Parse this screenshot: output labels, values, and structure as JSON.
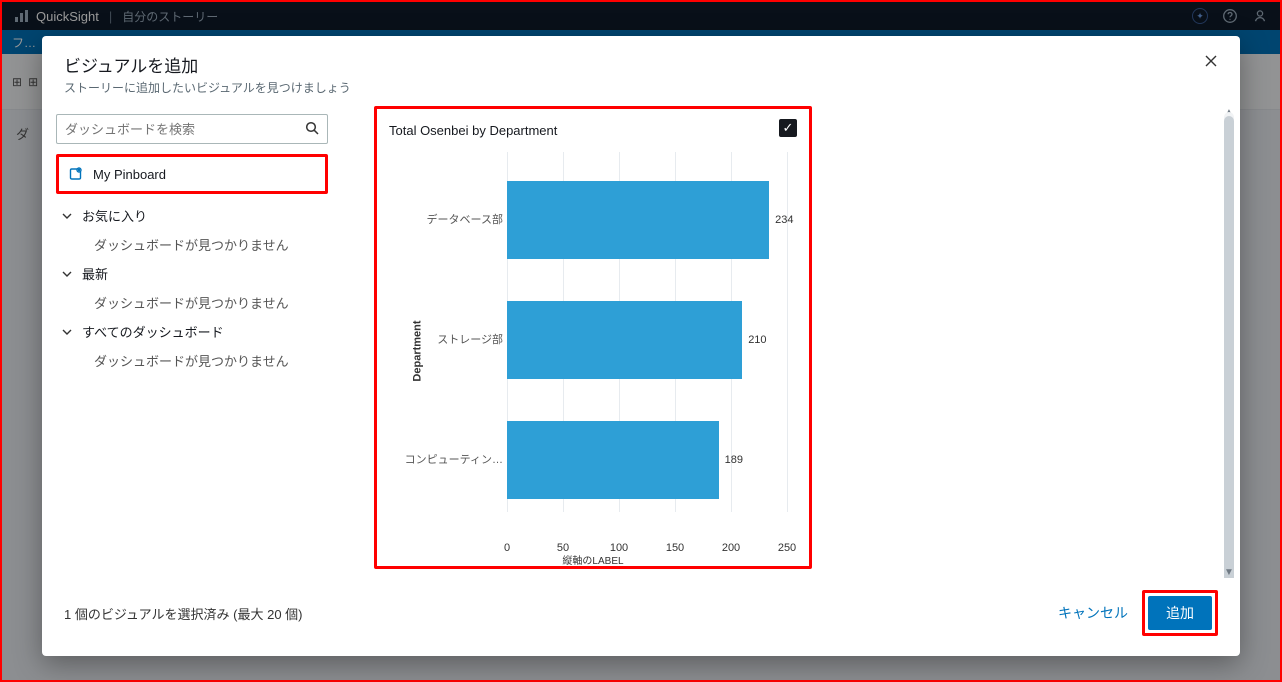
{
  "topbar": {
    "brand": "QuickSight",
    "story": "自分のストーリー"
  },
  "bg": {
    "tab1": "フ…",
    "left_label": "ダ"
  },
  "modal": {
    "title": "ビジュアルを追加",
    "subtitle": "ストーリーに追加したいビジュアルを見つけましょう"
  },
  "sidebar": {
    "search_placeholder": "ダッシュボードを検索",
    "pinboard": "My Pinboard",
    "groups": [
      {
        "label": "お気に入り",
        "empty": "ダッシュボードが見つかりません"
      },
      {
        "label": "最新",
        "empty": "ダッシュボードが見つかりません"
      },
      {
        "label": "すべてのダッシュボード",
        "empty": "ダッシュボードが見つかりません"
      }
    ]
  },
  "card": {
    "title": "Total Osenbei by Department"
  },
  "chart_data": {
    "type": "bar",
    "orientation": "horizontal",
    "title": "Total Osenbei by Department",
    "ylabel": "Department",
    "xlabel": "",
    "categories": [
      "データベース部",
      "ストレージ部",
      "コンピューティン…"
    ],
    "values": [
      234,
      210,
      189
    ],
    "xlim": [
      0,
      250
    ],
    "xticks": [
      0,
      50,
      100,
      150,
      200,
      250
    ],
    "color": "#2e9fd6"
  },
  "footer": {
    "selection": "1 個のビジュアルを選択済み (最大 20 個)",
    "cancel": "キャンセル",
    "add": "追加"
  }
}
